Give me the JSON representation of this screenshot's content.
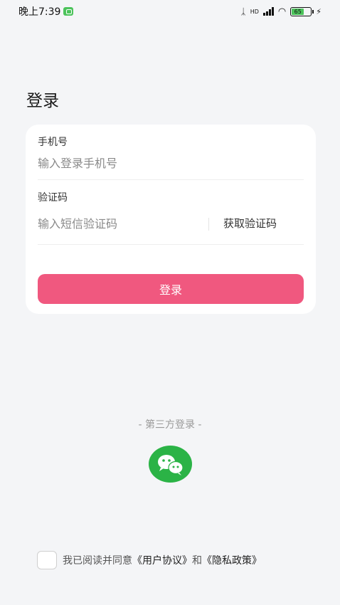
{
  "status_bar": {
    "time": "晚上7:39",
    "network": "HD",
    "battery": "65"
  },
  "page": {
    "title": "登录"
  },
  "form": {
    "phone_label": "手机号",
    "phone_placeholder": "输入登录手机号",
    "code_label": "验证码",
    "code_placeholder": "输入短信验证码",
    "get_code_label": "获取验证码",
    "login_label": "登录"
  },
  "third_party": {
    "title": "- 第三方登录 -",
    "wechat_icon": "wechat-icon"
  },
  "agreement": {
    "prefix": "我已阅读并同意",
    "user_agreement": "《用户协议》",
    "and": "和",
    "privacy_policy": "《隐私政策》"
  },
  "colors": {
    "accent": "#f0587f",
    "wechat": "#2bb346",
    "background": "#f4f5f7"
  }
}
